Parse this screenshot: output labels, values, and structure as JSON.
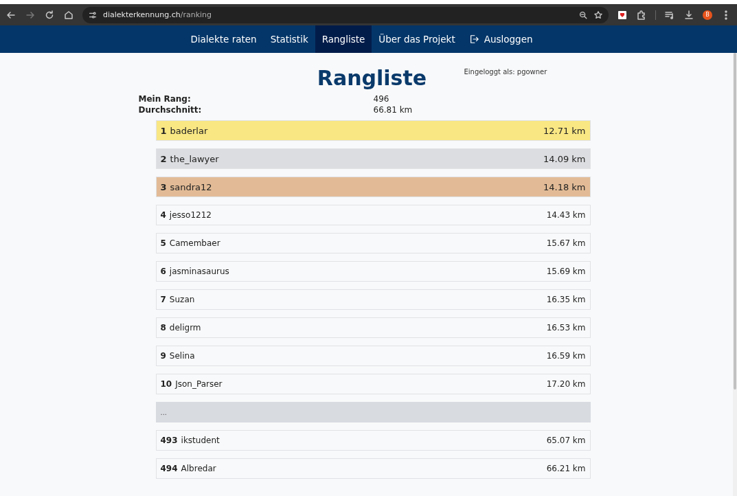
{
  "browser": {
    "url_host": "dialekterkennung.ch",
    "url_path": "/ranking",
    "profile_initial": "B",
    "forward_disabled": true
  },
  "nav": {
    "items": [
      {
        "label": "Dialekte raten",
        "selected": false,
        "kind": "link"
      },
      {
        "label": "Statistik",
        "selected": false,
        "kind": "link"
      },
      {
        "label": "Rangliste",
        "selected": true,
        "kind": "link"
      },
      {
        "label": "Über das Projekt",
        "selected": false,
        "kind": "link"
      },
      {
        "label": "Ausloggen",
        "selected": false,
        "kind": "logout"
      }
    ]
  },
  "login_note": "Eingeloggt als: pgowner",
  "title": "Rangliste",
  "summary": [
    {
      "label": "Mein Rang:",
      "value": "496"
    },
    {
      "label": "Durchschnitt:",
      "value": "66.81 km"
    }
  ],
  "ranking": [
    {
      "kind": "gold",
      "rank": "1",
      "name": "baderlar",
      "distance": "12.71 km"
    },
    {
      "kind": "silver",
      "rank": "2",
      "name": "the_lawyer",
      "distance": "14.09 km"
    },
    {
      "kind": "bronze",
      "rank": "3",
      "name": "sandra12",
      "distance": "14.18 km"
    },
    {
      "kind": "normal",
      "rank": "4",
      "name": "jesso1212",
      "distance": "14.43 km"
    },
    {
      "kind": "normal",
      "rank": "5",
      "name": "Camembaer",
      "distance": "15.67 km"
    },
    {
      "kind": "normal",
      "rank": "6",
      "name": "jasminasaurus",
      "distance": "15.69 km"
    },
    {
      "kind": "normal",
      "rank": "7",
      "name": "Suzan",
      "distance": "16.35 km"
    },
    {
      "kind": "normal",
      "rank": "8",
      "name": "deligrm",
      "distance": "16.53 km"
    },
    {
      "kind": "normal",
      "rank": "9",
      "name": "Selina",
      "distance": "16.59 km"
    },
    {
      "kind": "normal",
      "rank": "10",
      "name": "Json_Parser",
      "distance": "17.20 km"
    },
    {
      "kind": "gap",
      "name": "..."
    },
    {
      "kind": "normal",
      "rank": "493",
      "name": "ikstudent",
      "distance": "65.07 km"
    },
    {
      "kind": "normal",
      "rank": "494",
      "name": "Albredar",
      "distance": "66.21 km"
    }
  ]
}
